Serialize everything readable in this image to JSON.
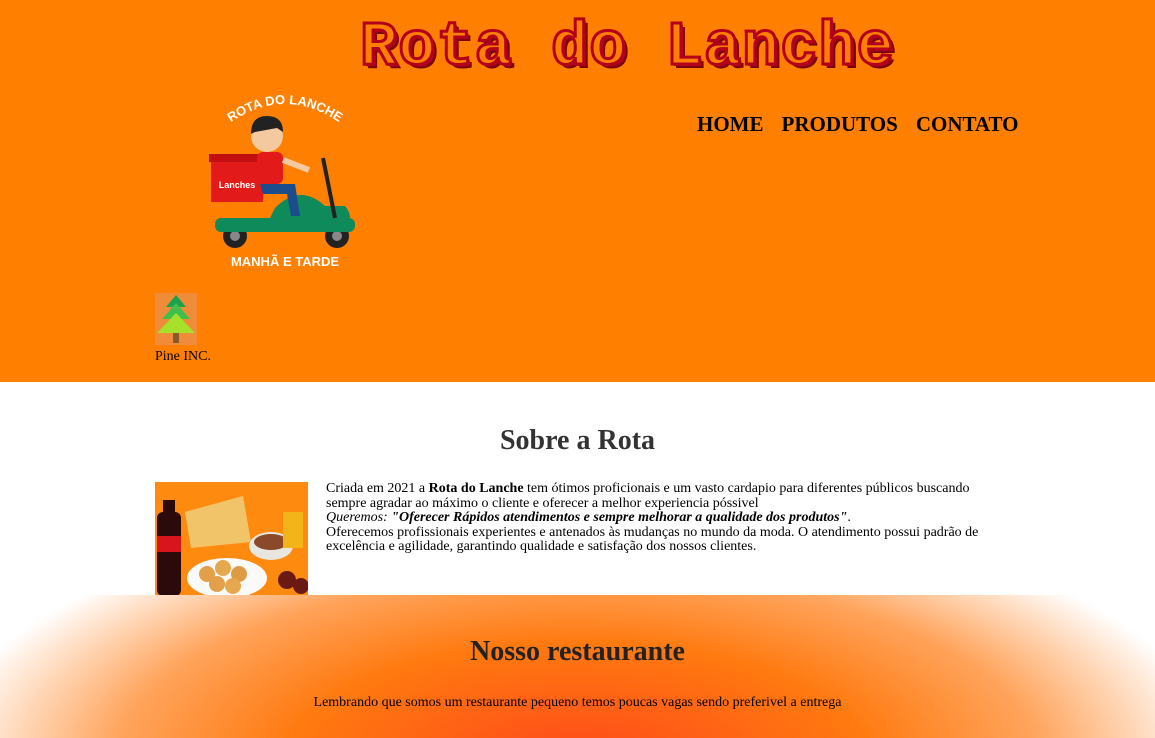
{
  "header": {
    "brand_title": "Rota do Lanche",
    "logo": {
      "top_text": "ROTA DO LANCHE",
      "box_text": "Lanches",
      "bottom_text": "MANHÃ E TARDE"
    },
    "nav": [
      {
        "label": "HOME"
      },
      {
        "label": "PRODUTOS"
      },
      {
        "label": "CONTATO"
      }
    ],
    "pine_label": "Pine INC."
  },
  "about": {
    "title_cap": "S",
    "title_rest": "obre a Rota",
    "line1_a": "Criada em 2021 a ",
    "line1_bold": "Rota do Lanche",
    "line1_b": " tem ótimos proficionais e um vasto cardapio para diferentes públicos buscando sempre agradar ao máximo o cliente e oferecer a melhor experiencia póssivel",
    "line2_italic": "Queremos: ",
    "line2_bold_italic": "\"Oferecer Rápidos atendimentos e sempre melhorar a qualidade dos produtos\"",
    "line2_end": ".",
    "line3": "Oferecemos profissionais experientes e antenados às mudanças no mundo da moda. O atendimento possui padrão de excelência e agilidade, garantindo qualidade e satisfação dos nossos clientes."
  },
  "restaurant": {
    "title_cap": "N",
    "title_rest": "osso restaurante",
    "text": "Lembrando que somos um restaurante pequeno temos poucas vagas sendo preferivel a entrega"
  },
  "colors": {
    "header_bg": "#ff7f00",
    "title_red": "#b3001b",
    "gradient_center": "#ff4a1a"
  }
}
